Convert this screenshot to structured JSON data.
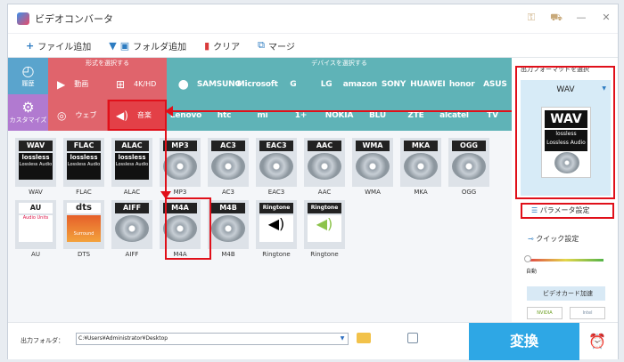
{
  "title": "ビデオコンバータ",
  "toolbar": {
    "add_file": "ファイル追加",
    "add_folder": "フォルダ追加",
    "clear": "クリア",
    "merge": "マージ"
  },
  "categories": {
    "history": "履歴",
    "customize": "カスタマイズ",
    "format_header": "形式を選択する",
    "device_header": "デバイスを選択する",
    "formats": [
      "動画",
      "4K/HD",
      "ウェブ",
      "音楽"
    ]
  },
  "brands_row1": [
    "",
    "SAMSUNG",
    "Microsoft",
    "G",
    "LG",
    "amazon",
    "SONY",
    "HUAWEI",
    "honor",
    "ASUS"
  ],
  "brands_row2": [
    "Lenovo",
    "htc",
    "mi",
    "1+",
    "NOKIA",
    "BLU",
    "ZTE",
    "alcatel",
    "TV"
  ],
  "audio_formats": [
    {
      "tag": "WAV",
      "label": "WAV",
      "gfx": "lossless",
      "sub": "Lossless Audio"
    },
    {
      "tag": "FLAC",
      "label": "FLAC",
      "gfx": "lossless",
      "sub": "Lossless Audio"
    },
    {
      "tag": "ALAC",
      "label": "ALAC",
      "gfx": "lossless",
      "sub": "Lossless Audio"
    },
    {
      "tag": "MP3",
      "label": "MP3",
      "gfx": "disc",
      "sub": ""
    },
    {
      "tag": "AC3",
      "label": "AC3",
      "gfx": "disc",
      "sub": ""
    },
    {
      "tag": "EAC3",
      "label": "EAC3",
      "gfx": "disc",
      "sub": ""
    },
    {
      "tag": "AAC",
      "label": "AAC",
      "gfx": "disc",
      "sub": ""
    },
    {
      "tag": "WMA",
      "label": "WMA",
      "gfx": "disc",
      "sub": ""
    },
    {
      "tag": "MKA",
      "label": "MKA",
      "gfx": "disc",
      "sub": ""
    },
    {
      "tag": "OGG",
      "label": "OGG",
      "gfx": "disc",
      "sub": ""
    },
    {
      "tag": "AU",
      "label": "AU",
      "gfx": "au",
      "sub": "Audio Units"
    },
    {
      "tag": "dts",
      "label": "DTS",
      "gfx": "dts",
      "sub": "Surround"
    },
    {
      "tag": "AIFF",
      "label": "AIFF",
      "gfx": "disc",
      "sub": ""
    },
    {
      "tag": "M4A",
      "label": "M4A",
      "gfx": "disc",
      "sub": ""
    },
    {
      "tag": "M4B",
      "label": "M4B",
      "gfx": "disc",
      "sub": ""
    },
    {
      "tag": "Ringtone",
      "label": "Ringtone",
      "gfx": "apple",
      "sub": ""
    },
    {
      "tag": "Ringtone",
      "label": "Ringtone",
      "gfx": "android",
      "sub": ""
    }
  ],
  "side": {
    "title": "出力フォーマットを選択",
    "selected": "WAV",
    "icon_sub": "Lossless Audio",
    "param": "パラメータ設定",
    "quick": "クイック設定",
    "auto": "自動",
    "gpu": "ビデオカード加速",
    "nvidia": "NVIDIA",
    "intel": "Intel"
  },
  "bottom": {
    "output_label": "出力フォルダ：",
    "output_path": "C:¥Users¥Administrator¥Desktop",
    "convert": "変換"
  }
}
